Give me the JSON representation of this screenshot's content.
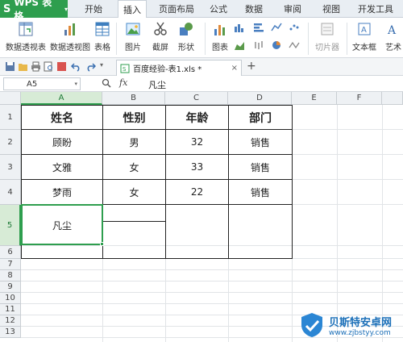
{
  "app": {
    "title": "WPS 表格",
    "brand_color": "#2e9e4e"
  },
  "menu": {
    "tabs": [
      {
        "label": "开始"
      },
      {
        "label": "插入"
      },
      {
        "label": "页面布局"
      },
      {
        "label": "公式"
      },
      {
        "label": "数据"
      },
      {
        "label": "审阅"
      },
      {
        "label": "视图"
      },
      {
        "label": "开发工具"
      }
    ],
    "active_tab": "插入"
  },
  "ribbon": {
    "pivot_table": "数据透视表",
    "pivot_chart": "数据透视图",
    "table": "表格",
    "picture": "图片",
    "screenshot": "截屏",
    "shapes": "形状",
    "chart": "图表",
    "slicer": "切片器",
    "textbox": "文本框",
    "wordart": "艺术"
  },
  "document_tab": {
    "label": "百度经验-表1.xls *",
    "close": "×",
    "add": "+"
  },
  "formula_bar": {
    "name_box": "A5",
    "fx": "fx",
    "content": "凡尘"
  },
  "columns": [
    "A",
    "B",
    "C",
    "D",
    "E",
    "F"
  ],
  "rows": [
    "1",
    "2",
    "3",
    "4",
    "5",
    "6",
    "7",
    "8",
    "9",
    "10",
    "11",
    "12",
    "13"
  ],
  "table": {
    "headers": [
      "姓名",
      "性别",
      "年龄",
      "部门"
    ],
    "rows": [
      [
        "顾盼",
        "男",
        "32",
        "销售"
      ],
      [
        "文雅",
        "女",
        "33",
        "销售"
      ],
      [
        "梦雨",
        "女",
        "22",
        "销售"
      ]
    ],
    "a5": "凡尘"
  },
  "watermark": {
    "title": "贝斯特安卓网",
    "url": "www.zjbstyy.com"
  }
}
